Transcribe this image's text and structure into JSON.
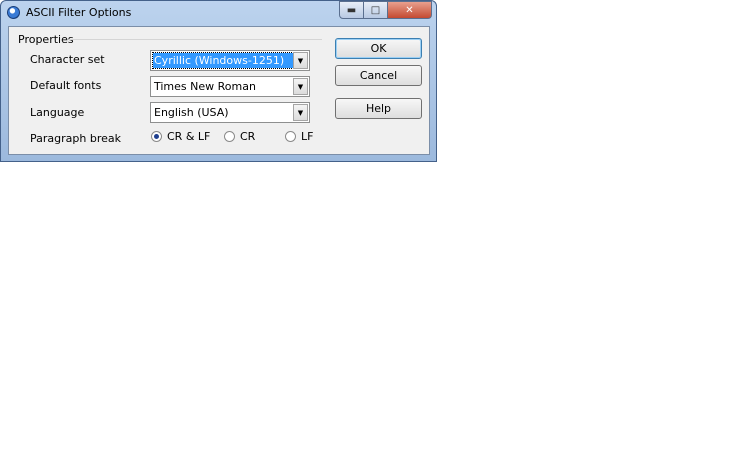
{
  "window": {
    "title": "ASCII Filter Options",
    "caption": {
      "minimize": "▬",
      "maximize": "□",
      "close": "✕"
    }
  },
  "properties": {
    "group_label": "Properties",
    "character_set": {
      "label": "Character set",
      "value": "Cyrillic (Windows-1251)"
    },
    "default_fonts": {
      "label": "Default fonts",
      "value": "Times New Roman"
    },
    "language": {
      "label": "Language",
      "value": "English (USA)"
    },
    "paragraph_break": {
      "label": "Paragraph break",
      "options": [
        "CR & LF",
        "CR",
        "LF"
      ],
      "selected": "CR & LF"
    }
  },
  "buttons": {
    "ok": "OK",
    "cancel": "Cancel",
    "help": "Help"
  },
  "icons": {
    "dropdown": "chevron-down-icon",
    "app": "app-icon"
  },
  "colors": {
    "selection": "#3399ff",
    "close_button": "#c44a31",
    "titlebar": "#bcd3ee"
  }
}
